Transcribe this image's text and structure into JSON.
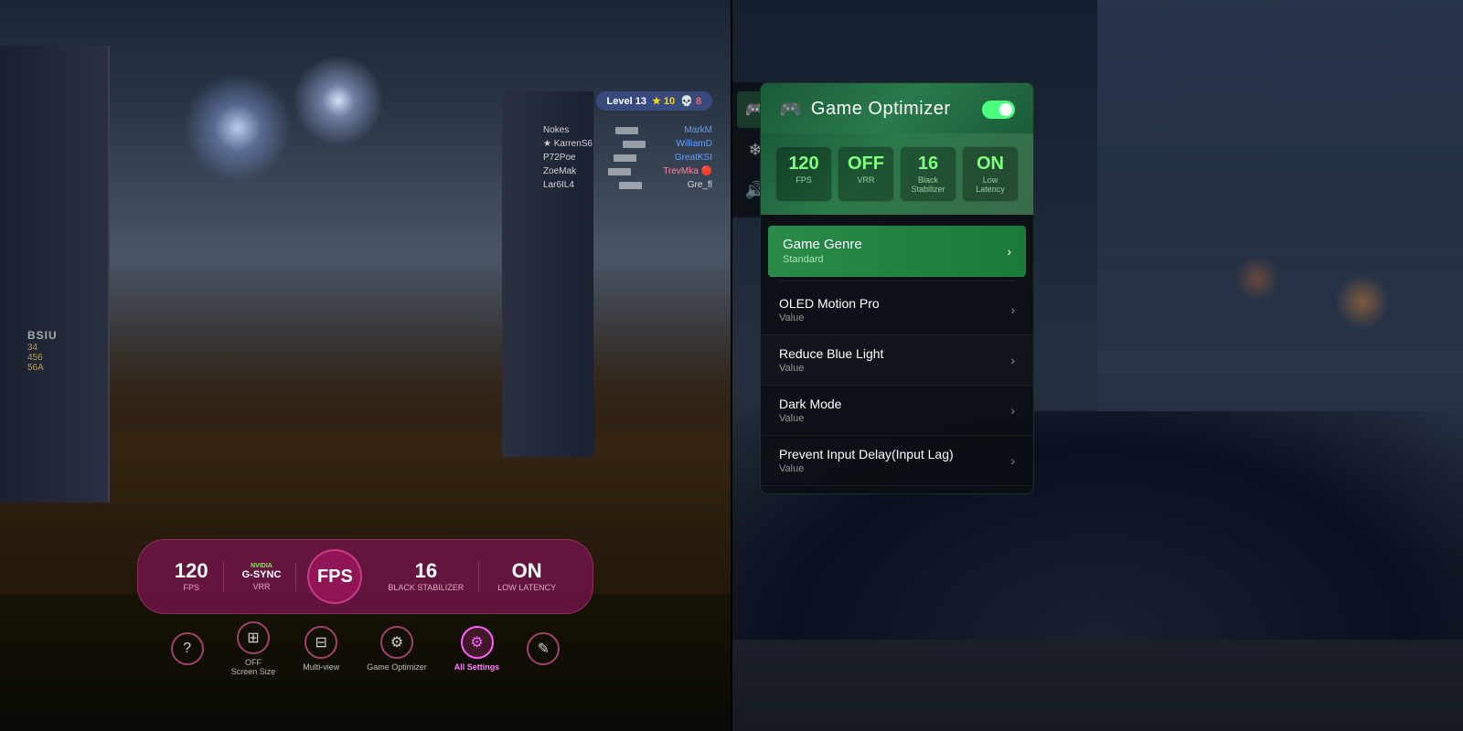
{
  "left_screen": {
    "building_label": "BSIU",
    "building_numbers": "34\n456\n56A",
    "level_bar": {
      "text": "Level 13",
      "stars": "★ 10",
      "skulls": "💀 8"
    },
    "players": [
      {
        "left": "Nokes",
        "right": "MarkM",
        "right_color": "blue"
      },
      {
        "left": "KarrenS6",
        "right": "WilliamD",
        "right_color": "blue"
      },
      {
        "left": "P72Poe",
        "right": "GreatKSI",
        "right_color": "blue"
      },
      {
        "left": "ZoeMak",
        "right": "TrevMka",
        "right_color": "pink"
      },
      {
        "left": "Lar6IL4",
        "right": "Gre_fl",
        "right_color": "white"
      }
    ],
    "stats": {
      "fps_value": "120",
      "fps_label": "FPS",
      "nvidia_brand": "NVIDIA",
      "gsync_label": "G-SYNC",
      "vrr_label": "VRR",
      "fps_big_label": "FPS",
      "black_stab_value": "16",
      "black_stab_label": "Black Stabilizer",
      "low_lat_value": "ON",
      "low_lat_label": "Low Latency"
    },
    "controls": {
      "help_label": "?",
      "screen_size_label": "OFF\nScreen Size",
      "multiview_label": "Multi-view",
      "game_optimizer_label": "Game Optimizer",
      "all_settings_label": "All Settings",
      "edit_label": "✎"
    }
  },
  "right_screen": {
    "sidebar_icons": [
      "🎮",
      "❄",
      "🔊"
    ],
    "panel": {
      "title": "Game Optimizer",
      "toggle": "on",
      "stats": [
        {
          "value": "120",
          "label": "FPS"
        },
        {
          "value": "OFF",
          "label": "VRR"
        },
        {
          "value": "16",
          "label": "Black Stabilizer"
        },
        {
          "value": "ON",
          "label": "Low Latency"
        }
      ],
      "menu_items": [
        {
          "title": "Game Genre",
          "value": "Standard",
          "highlighted": true
        },
        {
          "title": "OLED Motion Pro",
          "value": "Value",
          "highlighted": false
        },
        {
          "title": "Reduce Blue Light",
          "value": "Value",
          "highlighted": false
        },
        {
          "title": "Dark Mode",
          "value": "Value",
          "highlighted": false
        },
        {
          "title": "Prevent Input Delay(Input Lag)",
          "value": "Value",
          "highlighted": false
        }
      ]
    }
  }
}
